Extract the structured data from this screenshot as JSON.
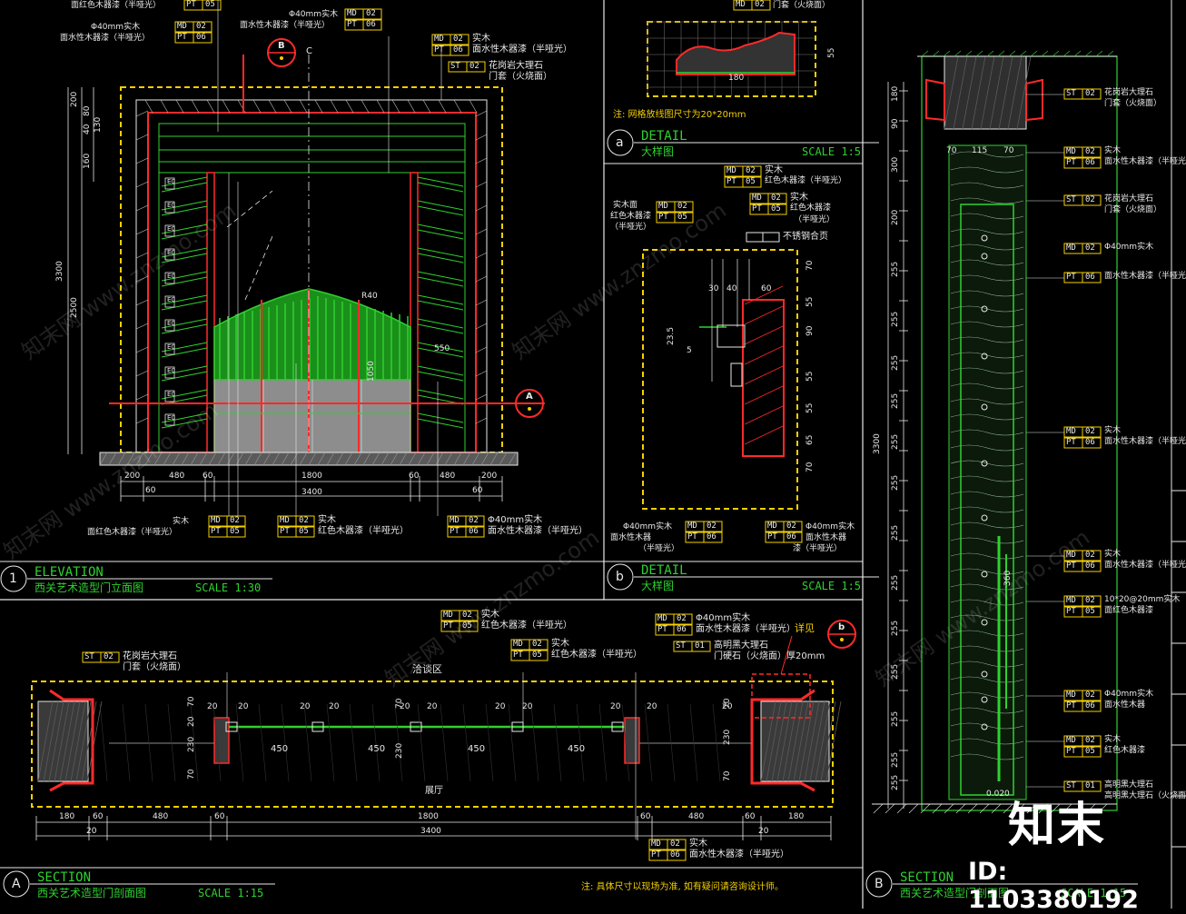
{
  "sheet": {
    "panels": [
      {
        "id": "1",
        "en": "ELEVATION",
        "cn": "西关艺术造型门立面图",
        "scale": "SCALE 1:30"
      },
      {
        "id": "a",
        "en": "DETAIL",
        "cn": "大样图",
        "scale": "SCALE 1:5"
      },
      {
        "id": "b",
        "en": "DETAIL",
        "cn": "大样图",
        "scale": "SCALE 1:5"
      },
      {
        "id": "A",
        "en": "SECTION",
        "cn": "西关艺术造型门剖面图",
        "scale": "SCALE 1:15"
      },
      {
        "id": "B",
        "en": "SECTION",
        "cn": "西关艺术造型门剖面图",
        "scale": "SCALE 1:15"
      }
    ],
    "notes": {
      "grid": "注: 网格放线图尺寸为20*20mm",
      "general": "注: 具体尺寸以现场为准, 如有疑问请咨询设计师。",
      "detail_ref": "详见",
      "zone_top": "洽谈区",
      "zone_bottom": "展厅"
    },
    "section_marks": {
      "B": "B",
      "C": "C",
      "A": "A",
      "b": "b"
    }
  },
  "tags": {
    "MD02": [
      "MD",
      "02"
    ],
    "PT05": [
      "PT",
      "05"
    ],
    "PT06": [
      "PT",
      "06"
    ],
    "ST02": [
      "ST",
      "02"
    ],
    "ST01": [
      "ST",
      "01"
    ],
    "MD01": [
      "MD",
      "01"
    ]
  },
  "materials": {
    "solid_wood": "实木",
    "red_paint": "红色木器漆（半哑光）",
    "red_paint_short": "红色木器漆",
    "semi_gloss": "（半哑光）",
    "wb_paint": "面水性木器漆（半哑光）",
    "wb_paint_short": "面水性木器漆",
    "wb_paint_1": "面水性木器",
    "wb_paint_2": "漆（半哑光）",
    "granite": "花岗岩大理石",
    "granite_sub": "门套（火烧面）",
    "steel_hinge": "不锈钢合页",
    "phi40": "Φ40mm实木",
    "wood_1020": "10*20@20mm实木",
    "black_marble": "高明黑大理石",
    "black_marble_sub": "门硬石（火烧面）厚20mm",
    "black_marble_b": "高明黑大理石（火烧面）厚20mm",
    "red_wood": "面红色木器漆"
  },
  "dims": {
    "elev_bottom": [
      "200",
      "480",
      "60",
      "1800",
      "60",
      "480",
      "200"
    ],
    "elev_total": "3400",
    "elev_left": [
      "200",
      "80",
      "40",
      "130",
      "160",
      "3300",
      "2500"
    ],
    "elev_r40": "R40",
    "elev_550": "550",
    "elev_1050": "1050",
    "det_a": [
      "180",
      "55"
    ],
    "det_b_top": [
      "30",
      "40",
      "60"
    ],
    "det_b_right": [
      "70",
      "55",
      "90",
      "55",
      "55",
      "65",
      "70"
    ],
    "det_b_left": [
      "5",
      "23.5"
    ],
    "sec_top": [
      "20",
      "20",
      "20",
      "20",
      "20",
      "20",
      "20",
      "20"
    ],
    "sec_mid": [
      "450",
      "450",
      "450",
      "450"
    ],
    "sec_left": [
      "70",
      "20",
      "230",
      "70"
    ],
    "sec_bottom": [
      "180",
      "60",
      "480",
      "60",
      "1800",
      "60",
      "480",
      "60",
      "180"
    ],
    "sec_total": "3400",
    "sec_20": "20",
    "side_dims": [
      "180",
      "90",
      "300",
      "200",
      "255",
      "255",
      "255",
      "255",
      "255",
      "255",
      "255",
      "255",
      "255",
      "255",
      "255",
      "255",
      "255"
    ],
    "side_total": "3300",
    "side_top": [
      "70",
      "115",
      "70"
    ],
    "side_bot": "0.020",
    "sec_360": "360"
  },
  "brand": {
    "logo": "知末",
    "id": "ID: 1103380192",
    "watermark": "知末网 www.znzmo.com"
  }
}
